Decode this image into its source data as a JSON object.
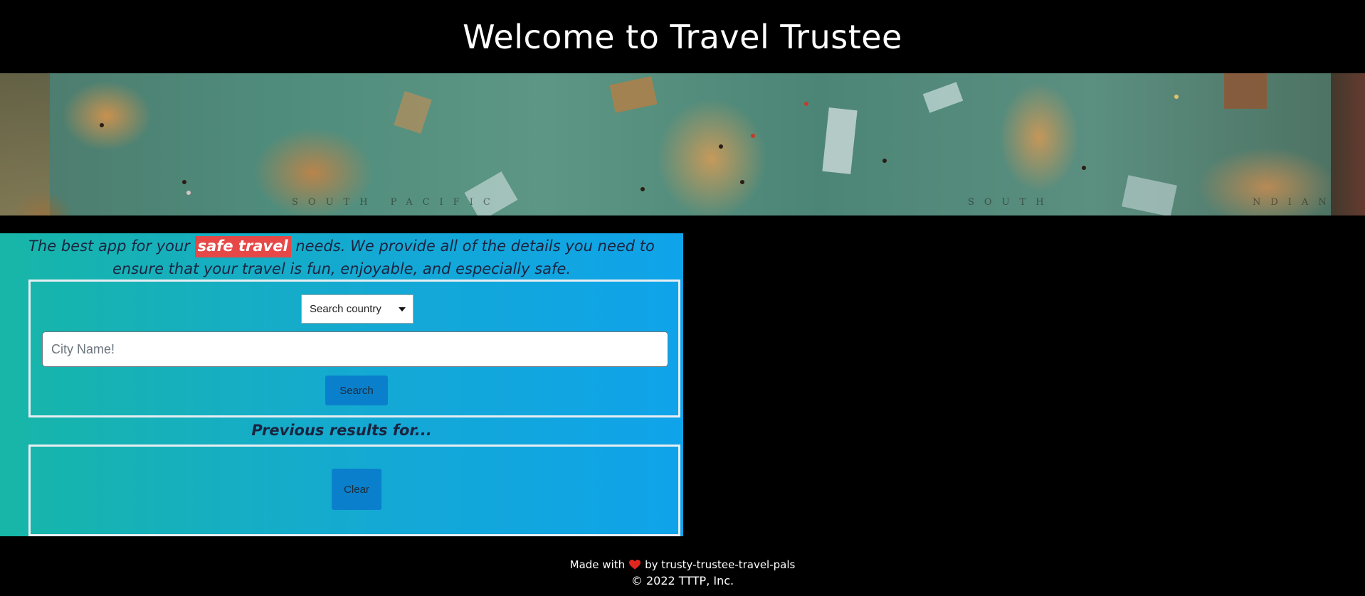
{
  "header": {
    "title": "Welcome to Travel Trustee"
  },
  "intro": {
    "before": "The best app for your ",
    "highlight": "safe travel",
    "after": " needs. We provide all of the details you need to ensure that your travel is fun, enjoyable, and especially safe."
  },
  "search": {
    "country_select": "Search country",
    "city_placeholder": "City Name!",
    "button_label": "Search"
  },
  "previous": {
    "title": "Previous results for...",
    "clear_label": "Clear"
  },
  "footer": {
    "made_with": "Made with",
    "by": "by trusty-trustee-travel-pals",
    "copyright": "© 2022 TTTP, Inc."
  },
  "colors": {
    "highlight": "#e64848",
    "button": "#0a80cc",
    "heart": "#e0261f"
  },
  "icons": {
    "heart": "heart-icon",
    "dropdown": "chevron-down-icon"
  }
}
